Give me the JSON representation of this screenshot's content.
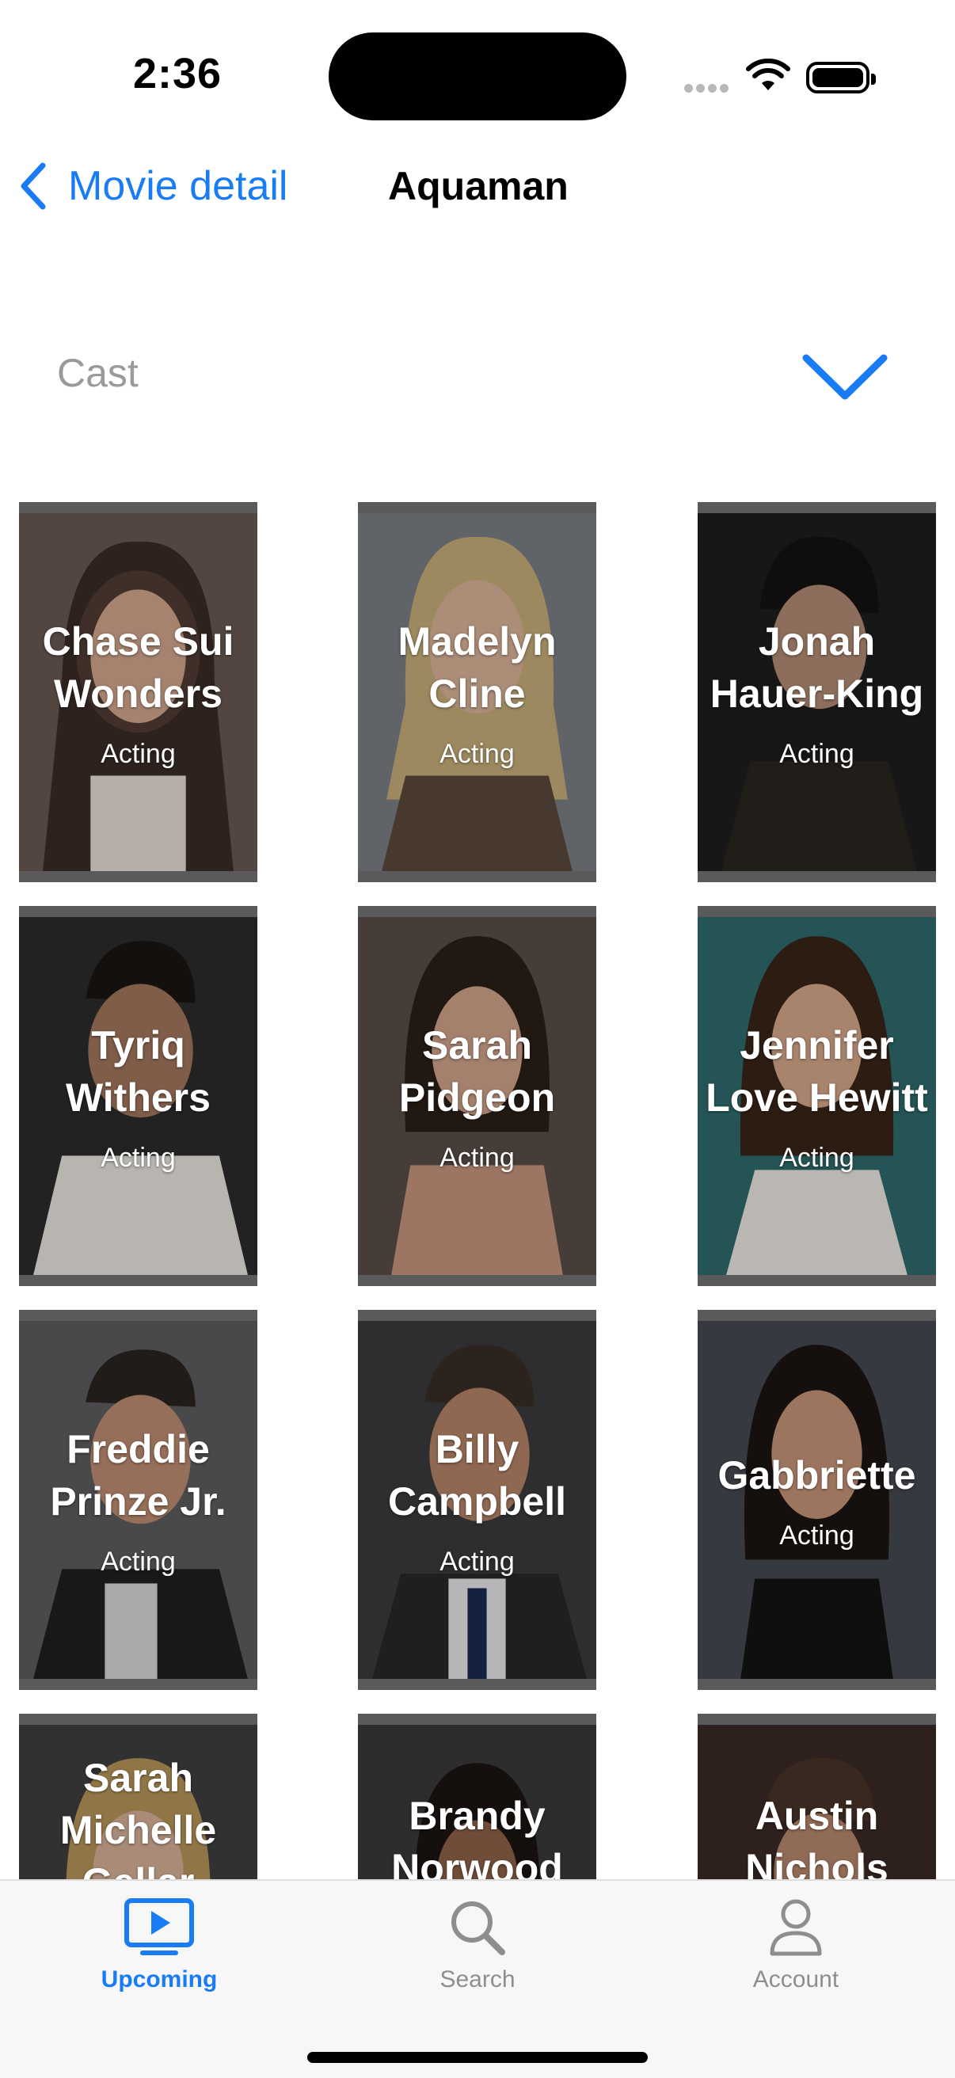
{
  "status_bar": {
    "time": "2:36"
  },
  "nav": {
    "back_label": "Movie detail",
    "title": "Aquaman"
  },
  "section": {
    "label": "Cast"
  },
  "cast": [
    {
      "name": "Chase Sui Wonders",
      "role": "Acting"
    },
    {
      "name": "Madelyn Cline",
      "role": "Acting"
    },
    {
      "name": "Jonah Hauer-King",
      "role": "Acting"
    },
    {
      "name": "Tyriq Withers",
      "role": "Acting"
    },
    {
      "name": "Sarah Pidgeon",
      "role": "Acting"
    },
    {
      "name": "Jennifer Love Hewitt",
      "role": "Acting"
    },
    {
      "name": "Freddie Prinze Jr.",
      "role": "Acting"
    },
    {
      "name": "Billy Campbell",
      "role": "Acting"
    },
    {
      "name": "Gabbriette",
      "role": "Acting"
    },
    {
      "name": "Sarah Michelle Gellar",
      "role": ""
    },
    {
      "name": "Brandy Norwood",
      "role": ""
    },
    {
      "name": "Austin Nichols",
      "role": ""
    }
  ],
  "tabbar": {
    "tabs": [
      {
        "label": "Upcoming",
        "icon": "play-tv-icon",
        "active": true
      },
      {
        "label": "Search",
        "icon": "magnifier-icon",
        "active": false
      },
      {
        "label": "Account",
        "icon": "person-icon",
        "active": false
      }
    ]
  },
  "colors": {
    "accent": "#1a7cf5",
    "inactive": "#8e8e8e",
    "card_frame": "#5a5a5a"
  }
}
